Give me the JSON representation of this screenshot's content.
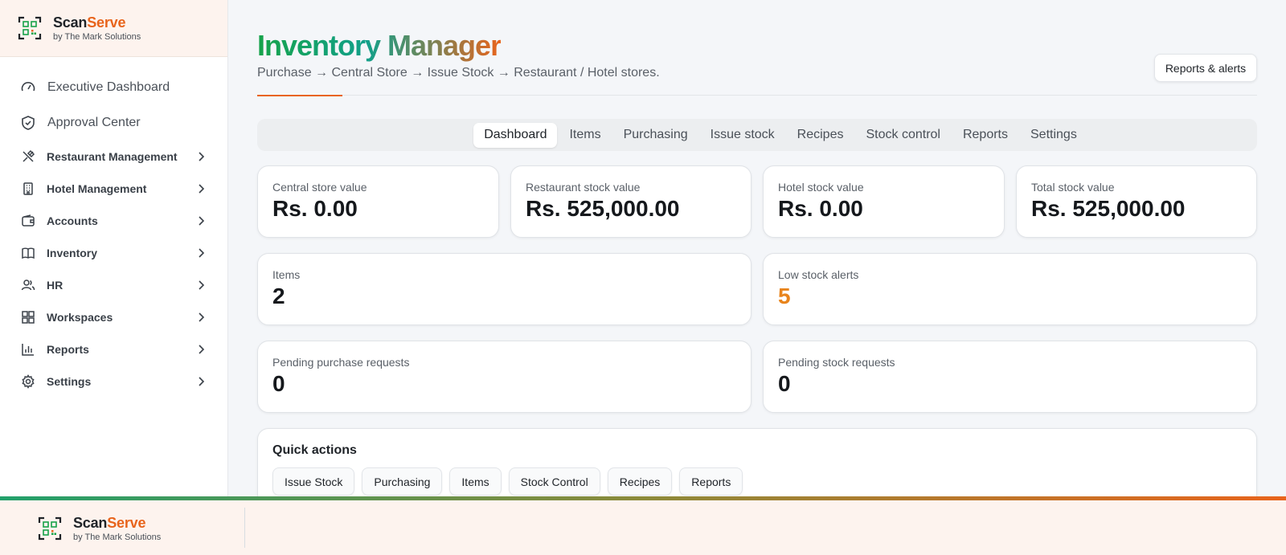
{
  "brand": {
    "name_a": "Scan",
    "name_b": "Serve",
    "sub": "by The Mark Solutions"
  },
  "sidebar": {
    "top_items": [
      {
        "label": "Executive Dashboard",
        "icon": "gauge-icon"
      },
      {
        "label": "Approval Center",
        "icon": "shield-check-icon"
      }
    ],
    "items": [
      {
        "label": "Restaurant Management",
        "icon": "utensils-icon"
      },
      {
        "label": "Hotel Management",
        "icon": "building-icon"
      },
      {
        "label": "Accounts",
        "icon": "wallet-icon"
      },
      {
        "label": "Inventory",
        "icon": "book-icon"
      },
      {
        "label": "HR",
        "icon": "users-icon"
      },
      {
        "label": "Workspaces",
        "icon": "grid-icon"
      },
      {
        "label": "Reports",
        "icon": "bar-chart-icon"
      },
      {
        "label": "Settings",
        "icon": "gear-icon"
      }
    ]
  },
  "header": {
    "title": "Inventory Manager",
    "subtitle": "Purchase → Central Store → Issue Stock → Restaurant / Hotel stores.",
    "reports_button": "Reports & alerts"
  },
  "tabs": [
    "Dashboard",
    "Items",
    "Purchasing",
    "Issue stock",
    "Recipes",
    "Stock control",
    "Reports",
    "Settings"
  ],
  "active_tab": "Dashboard",
  "stats": {
    "central_store": {
      "label": "Central store value",
      "value": "Rs. 0.00"
    },
    "restaurant_stock": {
      "label": "Restaurant stock value",
      "value": "Rs. 525,000.00"
    },
    "hotel_stock": {
      "label": "Hotel stock value",
      "value": "Rs. 0.00"
    },
    "total_stock": {
      "label": "Total stock value",
      "value": "Rs. 525,000.00"
    },
    "items": {
      "label": "Items",
      "value": "2"
    },
    "low_stock": {
      "label": "Low stock alerts",
      "value": "5"
    },
    "pending_purchase": {
      "label": "Pending purchase requests",
      "value": "0"
    },
    "pending_stock": {
      "label": "Pending stock requests",
      "value": "0"
    }
  },
  "quick_actions": {
    "title": "Quick actions",
    "buttons": [
      "Issue Stock",
      "Purchasing",
      "Items",
      "Stock Control",
      "Recipes",
      "Reports"
    ]
  },
  "colors": {
    "accent": "#e8641c",
    "green": "#16a34a",
    "warn": "#e8841c"
  }
}
